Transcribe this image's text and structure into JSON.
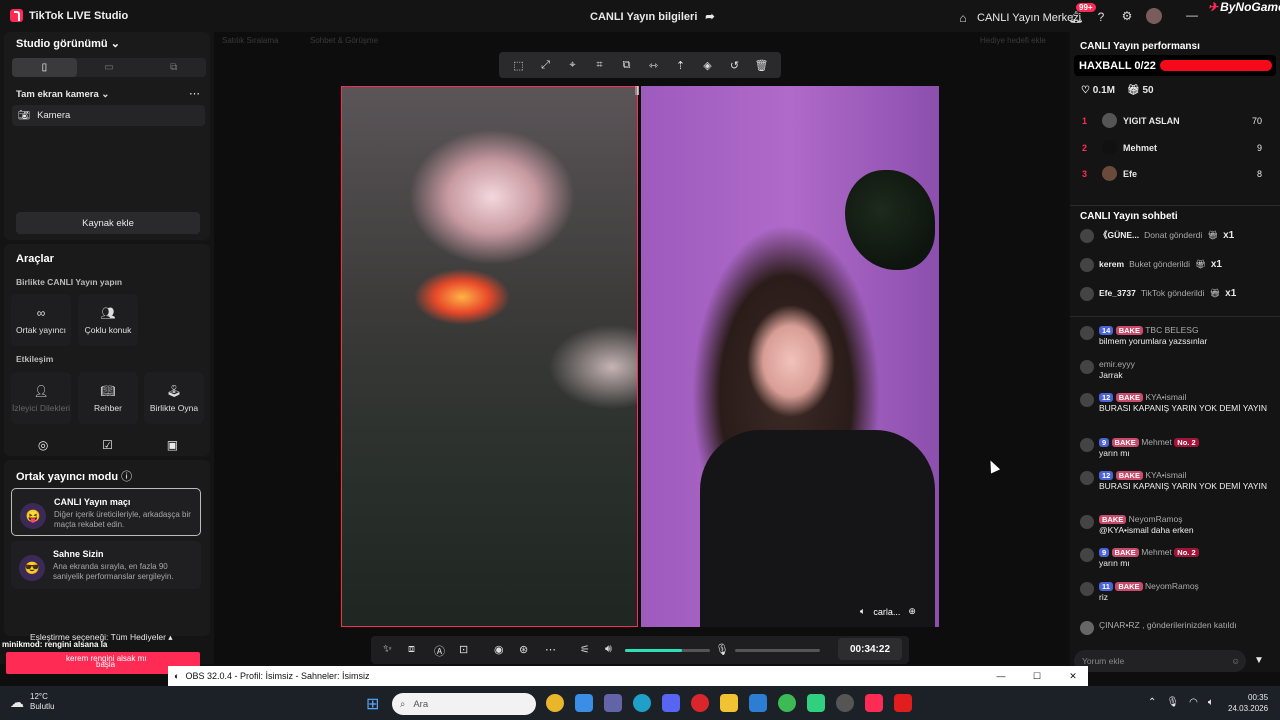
{
  "titlebar": {
    "app_name": "TikTok LIVE Studio",
    "center_title": "CANLI Yayın bilgileri",
    "live_center": "CANLI Yayın Merkezi",
    "notif_badge": "99+",
    "watermark": "ByNoGame"
  },
  "left": {
    "studio_view": "Studio görünümü",
    "camera_section": "Tam ekran kamera",
    "camera_item": "Kamera",
    "add_source": "Kaynak ekle",
    "tools_title": "Araçlar",
    "together_live": "Birlikte CANLI Yayın yapın",
    "co_host": "Ortak yayıncı",
    "multi_guest": "Çoklu konuk",
    "interaction": "Etkileşim",
    "viewer_requests": "İzleyici Dilekleri",
    "guide": "Rehber",
    "play_together": "Birlikte Oyna",
    "cohost_mode": "Ortak yayıncı modu",
    "mode1_title": "CANLI Yayın maçı",
    "mode1_desc": "Diğer içerik üreticileriyle, arkadaşça bir maçta rekabet edin.",
    "mode2_title": "Sahne Sizin",
    "mode2_desc": "Ana ekranda sırayla, en fazla 90 saniyelik performanslar sergileyin.",
    "match_option": "Eşleştirme seçeneği: Tüm Hediyeler",
    "overlay_line1": "minikmod: rengini alsana la",
    "overlay_line2": "kerem rengini alsak mı",
    "overlay_line3": "başla"
  },
  "center": {
    "tag1": "Satılık Sıralama",
    "tag2": "Sohbet & Görüşme",
    "tag3": "Hediye hedefi ekle",
    "caption": "carla...",
    "timer": "00:34:22",
    "volume_level": 0.67
  },
  "right": {
    "perf_title": "CANLI Yayın performansı",
    "haxball": "HAXBALL 0/22",
    "likes": "0.1M",
    "gifts": "50",
    "ranking": [
      {
        "rank": "1",
        "name": "YIGIT ASLAN",
        "score": "70"
      },
      {
        "rank": "2",
        "name": "Mehmet",
        "score": "9"
      },
      {
        "rank": "3",
        "name": "Efe",
        "score": "8"
      }
    ],
    "chat_title": "CANLI Yayın sohbeti",
    "gifts_list": [
      {
        "name": "《GÜNE...",
        "action": "Donat gönderdi",
        "count": "x1"
      },
      {
        "name": "kerem",
        "action": "Buket gönderildi",
        "count": "x1"
      },
      {
        "name": "Efe_3737",
        "action": "TikTok gönderildi",
        "count": "x1"
      }
    ],
    "messages": [
      {
        "lv": "14",
        "bake": "BAKE",
        "user": "TBC BELESG",
        "text": "bilmem yorumlara yazssınlar"
      },
      {
        "lv": "",
        "bake": "",
        "user": "emir.eyyy",
        "text": "Jarrak"
      },
      {
        "lv": "12",
        "bake": "BAKE",
        "user": "KYA•ismail",
        "text": "BURASI KAPANIŞ YARIN YOK DEMİ YAYIN"
      },
      {
        "lv": "9",
        "bake": "BAKE",
        "user": "Mehmet",
        "no": "No. 2",
        "text": "yarın mı"
      },
      {
        "lv": "12",
        "bake": "BAKE",
        "user": "KYA•ismail",
        "text": "BURASI KAPANIŞ YARIN YOK DEMİ YAYIN"
      },
      {
        "lv": "",
        "bake": "BAKE",
        "user": "NeyomRamoş",
        "text": "@KYA•ismail daha erken"
      },
      {
        "lv": "9",
        "bake": "BAKE",
        "user": "Mehmet",
        "no": "No. 2",
        "text": "yarın mı"
      },
      {
        "lv": "11",
        "bake": "BAKE",
        "user": "NeyomRamoş",
        "text": "riz"
      }
    ],
    "joined": "ÇINAR•RZ , gönderilerinizden katıldı",
    "comment_placeholder": "Yorum ekle"
  },
  "obs": {
    "title": "OBS 32.0.4 - Profil: İsimsiz - Sahneler: İsimsiz"
  },
  "taskbar": {
    "temp": "12°C",
    "weather": "Bulutlu",
    "search": "Ara",
    "time": "00:35",
    "date": "24.03.2026"
  }
}
